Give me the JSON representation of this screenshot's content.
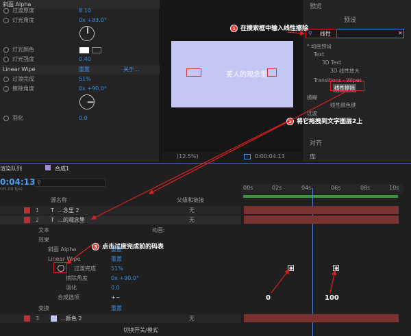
{
  "effect_controls": {
    "header": "斜面 Alpha",
    "rows": [
      {
        "label": "过渡厚度",
        "value": "8.10"
      },
      {
        "label": "灯光角度",
        "value": "0x +83.0°"
      },
      {
        "label": "灯光颜色",
        "value": ""
      },
      {
        "label": "灯光强度",
        "value": "0.40"
      }
    ],
    "linear_wipe": {
      "title": "Linear Wipe",
      "reset": "重置",
      "about": "关于...",
      "completion_label": "过渡完成",
      "completion": "51%",
      "angle_label": "擦除角度",
      "angle": "0x +90.0°",
      "feather_label": "羽化",
      "feather": "0.0"
    }
  },
  "viewer": {
    "comp_text": "美人的观念里",
    "zoom": "(12.5%)",
    "timecode": "0:00:04:13"
  },
  "right_panel": {
    "preview": "预览",
    "presets_tab": "预设",
    "search_value": "线性",
    "tree": [
      {
        "label": "* 动画预设",
        "level": 0
      },
      {
        "label": "Text",
        "level": 1
      },
      {
        "label": "3D Text",
        "level": 2
      },
      {
        "label": "3D 线性放大",
        "level": 3
      },
      {
        "label": "Transitions - Wipes",
        "level": 1
      },
      {
        "label": "线性擦除",
        "level": 2
      },
      {
        "label": "模糊",
        "level": 0
      },
      {
        "label": "线性颜色键",
        "level": 1
      },
      {
        "label": "过渡",
        "level": 0
      }
    ],
    "align": "对齐",
    "library": "库"
  },
  "timeline": {
    "render_queue": "渲染队列",
    "comp_tab": "合成1",
    "timecode": "0:04:13",
    "fps": "(25.00 fps)",
    "col_source": "源名称",
    "col_parent": "父级和链接",
    "ticks": [
      "00s",
      "02s",
      "04s",
      "06s",
      "08s",
      "10s"
    ],
    "layers": [
      {
        "num": "1",
        "name": "…念里 2",
        "parent": "无"
      },
      {
        "num": "2",
        "name": "…的观念里",
        "parent": "无"
      },
      {
        "num": "3",
        "name": "…颜色 2",
        "parent": "无"
      }
    ],
    "props": {
      "text": "文本",
      "anim": "动画:",
      "effects": "效果",
      "bevel": "斜面 Alpha",
      "reset": "重置",
      "wipe": "Linear Wipe",
      "completion": "过渡完成",
      "completion_val": "51%",
      "angle": "擦除角度",
      "angle_val": "0x +90.0°",
      "feather": "羽化",
      "feather_val": "0.0",
      "composite": "合成选项",
      "transform": "变换"
    },
    "footer": "切换开关/模式"
  },
  "annotations": {
    "n1": "1",
    "t1": "在搜索框中输入线性擦除",
    "n2": "2",
    "t2": "将它拖拽到文字图层2上",
    "n3": "3",
    "t3": "点击过度完成前的码表",
    "k0": "0",
    "k100": "100"
  },
  "colors": {
    "accent_blue": "#3d8ee6",
    "annotation_red": "#e02020",
    "layer_bar": "#7a3232",
    "comp_bg": "#c4c6f4"
  }
}
